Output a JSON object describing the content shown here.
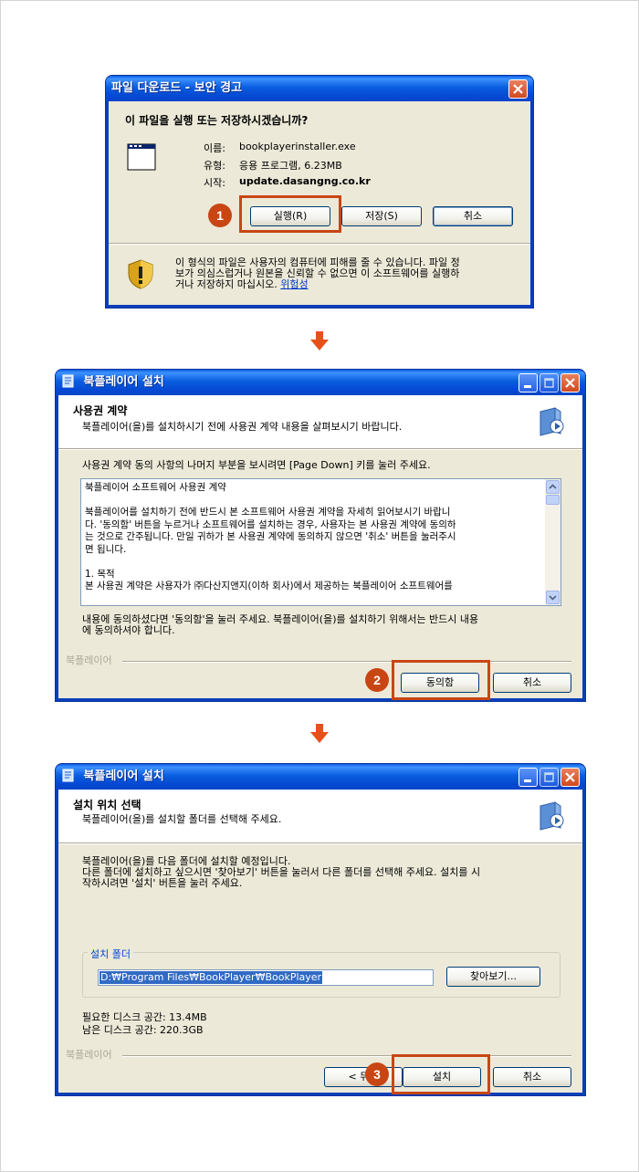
{
  "dialog1": {
    "title": "파일 다운로드 - 보안 경고",
    "question": "이 파일을 실행 또는 저장하시겠습니까?",
    "name_label": "이름:",
    "name_value": "bookplayerinstaller.exe",
    "type_label": "유형:",
    "type_value": "응용 프로그램, 6.23MB",
    "from_label": "시작:",
    "from_value": "update.dasangng.co.kr",
    "run_button": "실행(R)",
    "save_button": "저장(S)",
    "cancel_button": "취소",
    "warning_line1": "이 형식의 파일은 사용자의 컴퓨터에 피해를 줄 수 있습니다. 파일 정",
    "warning_line2": "보가 의심스럽거나 원본을 신뢰할 수 없으면 이 소프트웨어를 실행하",
    "warning_line3_prefix": "거나 저장하지 마십시오.",
    "warning_link": "위험성"
  },
  "dialog2": {
    "title": "북플레이어 설치",
    "header_title": "사용권 계약",
    "header_sub": "북플레이어(을)를 설치하시기 전에 사용권 계약 내용을 살펴보시기 바랍니다.",
    "instruction": "사용권 계약 동의 사항의 나머지 부분을 보시려면 [Page Down] 키를 눌러 주세요.",
    "license_lines": [
      "북플레이어 소프트웨어 사용권 계약",
      "",
      "북플레이어를 설치하기 전에 반드시 본 소프트웨어 사용권 계약을 자세히 읽어보시기 바랍니",
      "다. '동의함' 버튼을 누르거나 소프트웨어를 설치하는 경우, 사용자는 본 사용권 계약에 동의하",
      "는 것으로 간주됩니다. 만일 귀하가 본 사용권 계약에 동의하지 않으면 '취소' 버튼을 눌러주시",
      "면 됩니다.",
      "",
      "1. 목적",
      "본 사용권 계약은 사용자가 ㈜다산지앤지(이하 회사)에서 제공하는 북플레이어 소프트웨어를"
    ],
    "footer_line1": "내용에 동의하셨다면 '동의함'을 눌러 주세요. 북플레이어(을)를 설치하기 위해서는 반드시 내용",
    "footer_line2": "에 동의하셔야 합니다.",
    "brand": "북플레이어",
    "agree_button": "동의함",
    "cancel_button": "취소"
  },
  "dialog3": {
    "title": "북플레이어 설치",
    "header_title": "설치 위치 선택",
    "header_sub": "북플레이어(을)를 설치할 폴더를 선택해 주세요.",
    "desc_line1": "북플레이어(을)를 다음 폴더에 설치할 예정입니다.",
    "desc_line2": "다른 폴더에 설치하고 싶으시면 '찾아보기' 버튼을 눌러서 다른 폴더를 선택해 주세요. 설치를 시",
    "desc_line3": "작하시려면 '설치' 버튼을 눌러 주세요.",
    "group_label": "설치 폴더",
    "path_value": "D:₩Program Files₩BookPlayer₩BookPlayer",
    "browse_button": "찾아보기...",
    "required_space": "필요한 디스크 공간: 13.4MB",
    "free_space": "남은 디스크 공간: 220.3GB",
    "brand": "북플레이어",
    "back_button": "< 뒤로",
    "install_button": "설치",
    "cancel_button": "취소"
  },
  "steps": [
    "1",
    "2",
    "3"
  ]
}
